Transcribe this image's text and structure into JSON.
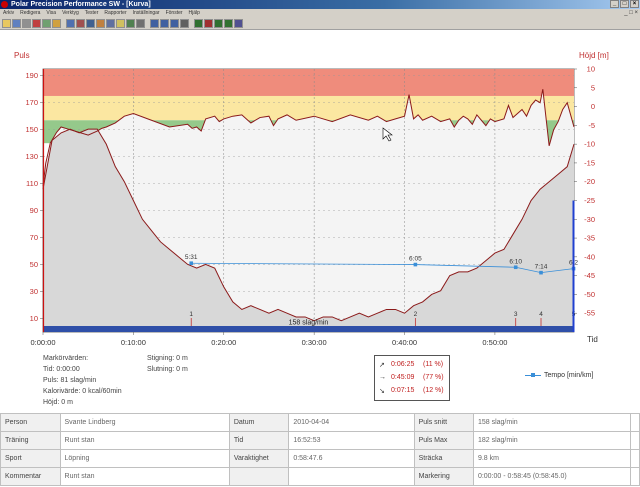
{
  "window": {
    "title": "Polar Precision Performance SW - [Kurva]"
  },
  "menu": [
    "Arkiv",
    "Redigera",
    "Visa",
    "Verktyg",
    "Tester",
    "Rapporter",
    "Inställningar",
    "Fönster",
    "Hjälp"
  ],
  "toolbar": [
    "open-icon",
    "save-icon",
    "print-icon",
    "cut-icon",
    "copy-icon",
    "paste-icon",
    "calendar-icon",
    "tests-icon",
    "exercise-icon",
    "person-icon",
    "report-icon",
    "folder-icon",
    "trend-icon",
    "tools-icon",
    "zoom-in-icon",
    "zoom-out-icon",
    "zoom-fit-icon",
    "search-icon",
    "bar-chart-icon",
    "heart-chart-icon",
    "altitude-chart-icon",
    "speed-chart-icon",
    "compare-icon"
  ],
  "chart_data": {
    "type": "line",
    "left_axis_label": "Puls",
    "right_axis_label": "Höjd [m]",
    "time_axis_label": "Tid",
    "y_left_ticks": [
      "190",
      "170",
      "150",
      "130",
      "110",
      "90",
      "70",
      "50",
      "30",
      "10"
    ],
    "y_right_ticks": [
      "10",
      "5",
      "0",
      "-5",
      "-10",
      "-15",
      "-20",
      "-25",
      "-30",
      "-35",
      "-40",
      "-45",
      "-50",
      "-55"
    ],
    "x_ticks": [
      "0:00:00",
      "0:10:00",
      "0:20:00",
      "0:30:00",
      "0:40:00",
      "0:50:00"
    ],
    "ylim_left": [
      0,
      195
    ],
    "ylim_right": [
      -60,
      10
    ],
    "zones": [
      {
        "from": 175,
        "to": 195,
        "color": "#ef8c7c"
      },
      {
        "from": 157,
        "to": 175,
        "color": "#fbe7a1"
      },
      {
        "from": 140,
        "to": 157,
        "color": "#95c98b"
      }
    ],
    "heart_rate": {
      "color": "#8b1a1a",
      "x": [
        0,
        0.3,
        0.8,
        1.5,
        2,
        3,
        4,
        5,
        6,
        6.5,
        7,
        8,
        9,
        10,
        12,
        14,
        16,
        16.5,
        17,
        17.5,
        18,
        19,
        19.5,
        20,
        21,
        22,
        23,
        24,
        25,
        25.5,
        26,
        27,
        28,
        30,
        32,
        34,
        36,
        37,
        38,
        39,
        40,
        40.5,
        41,
        41.5,
        42,
        43,
        44,
        45,
        45.5,
        46,
        46.5,
        47,
        47.5,
        48,
        48.5,
        49,
        49.5,
        50,
        51,
        51.5,
        52,
        52.5,
        53,
        53.5,
        54,
        54.5,
        55,
        55.3,
        55.6,
        56,
        56.5,
        57,
        57.5,
        58,
        58.75
      ],
      "y": [
        108,
        125,
        140,
        148,
        152,
        150,
        148,
        146,
        149,
        151,
        152,
        155,
        160,
        162,
        157,
        152,
        154,
        151,
        152,
        149,
        158,
        160,
        156,
        158,
        160,
        161,
        155,
        159,
        160,
        153,
        158,
        161,
        157,
        160,
        156,
        161,
        157,
        160,
        156,
        158,
        160,
        176,
        158,
        161,
        157,
        160,
        156,
        158,
        152,
        157,
        160,
        158,
        154,
        161,
        157,
        153,
        158,
        156,
        158,
        168,
        159,
        162,
        165,
        160,
        168,
        172,
        170,
        180,
        162,
        138,
        150,
        156,
        165,
        170,
        152
      ]
    },
    "altitude": {
      "fill": "#d8d8d8",
      "stroke": "#8b1a1a",
      "x": [
        0,
        1,
        2,
        3,
        4,
        5,
        6,
        7,
        8,
        9,
        10,
        11,
        12,
        13,
        14,
        15,
        16,
        17,
        18,
        19,
        20,
        21,
        22,
        23,
        24,
        25,
        26,
        27,
        28,
        29,
        30,
        31,
        32,
        33,
        34,
        35,
        36,
        37,
        38,
        39,
        40,
        41,
        42,
        43,
        44,
        45,
        46,
        47,
        48,
        49,
        50,
        51,
        52,
        53,
        54,
        55,
        56,
        57,
        58,
        58.75
      ],
      "y": [
        -22,
        -9,
        -7,
        -6,
        -7,
        -6,
        -6,
        -10,
        -16,
        -20,
        -25,
        -30,
        -33,
        -36,
        -38,
        -40,
        -42,
        -43,
        -42,
        -43,
        -48,
        -52,
        -54,
        -53,
        -54,
        -55,
        -54,
        -55,
        -56,
        -56,
        -57,
        -56,
        -56,
        -57,
        -56,
        -55,
        -56,
        -55,
        -54,
        -54,
        -55,
        -53,
        -52,
        -50,
        -49,
        -45,
        -44,
        -44,
        -43,
        -41,
        -39,
        -38,
        -34,
        -30,
        -25,
        -22,
        -20,
        -18,
        -16,
        -10
      ]
    },
    "pace": {
      "name": "Tempo [min/km]",
      "color": "#3a8fd8",
      "x": [
        16.4,
        41.2,
        52.3,
        55.1,
        58.7
      ],
      "labels": [
        "5:31",
        "6:05",
        "6:10",
        "7:14",
        "6:2"
      ],
      "y_pos": [
        51,
        50,
        48,
        44,
        47
      ]
    },
    "laps": [
      {
        "x": 16.4,
        "label": "1"
      },
      {
        "x": 41.2,
        "label": "2"
      },
      {
        "x": 52.3,
        "label": "3"
      },
      {
        "x": 55.1,
        "label": "4"
      },
      {
        "x": 58.7,
        "label": "5"
      }
    ],
    "cadence_bar": {
      "label": "158 slag/min",
      "color": "#2f4fa8"
    },
    "cursor_marker": {
      "color": "#cc1111"
    }
  },
  "marker": {
    "title": "Markörvärden:",
    "time": "Tid: 0:00:00",
    "pulse": "Puls: 81 slag/min",
    "calories": "Kalorivärde: 0 kcal/60min",
    "height": "Höjd: 0 m",
    "climb": "Stigning: 0 m",
    "descent": "Slutning: 0 m"
  },
  "ratios": [
    {
      "icon": "↗",
      "time": "0:06:25",
      "pct": "(11 %)"
    },
    {
      "icon": "→",
      "time": "0:45:09",
      "pct": "(77 %)"
    },
    {
      "icon": "↘",
      "time": "0:07:15",
      "pct": "(12 %)"
    }
  ],
  "legend": {
    "pace": "Tempo [min/km]"
  },
  "details": [
    [
      "Person",
      "Svante Lindberg",
      "Datum",
      "2010-04-04",
      "Puls snitt",
      "158 slag/min"
    ],
    [
      "Träning",
      "Runt stan",
      "Tid",
      "16:52:53",
      "Puls Max",
      "182 slag/min"
    ],
    [
      "Sport",
      "Löpning",
      "Varaktighet",
      "0:58:47.6",
      "Sträcka",
      "9.8 km"
    ],
    [
      "Kommentar",
      "Runt stan",
      "",
      "",
      "Markering",
      "0:00:00 - 0:58:45 (0:58:45.0)"
    ]
  ]
}
